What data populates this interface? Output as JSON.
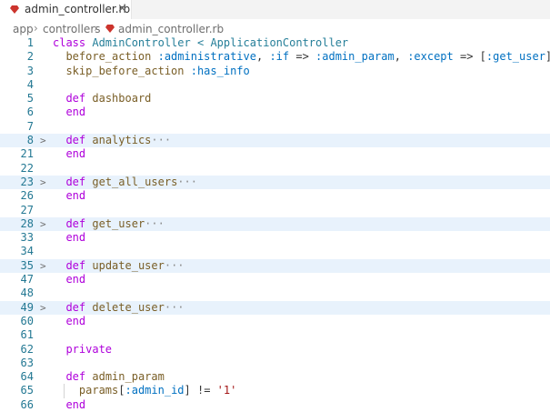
{
  "tab": {
    "filename": "admin_controller.rb",
    "close_glyph": "×"
  },
  "breadcrumb": {
    "parts": [
      "app",
      "controllers",
      "admin_controller.rb"
    ],
    "separator": "›"
  },
  "colors": {
    "keyword": "#0000ff",
    "control": "#af00db",
    "class": "#267f99",
    "symbol": "#0070c1",
    "function": "#795e26",
    "string": "#a31515",
    "line_number": "#237893",
    "fold_highlight": "#e8f2fc",
    "ruby_icon": "#cc342d"
  },
  "editor": {
    "lines": [
      {
        "num": "1",
        "fold": "",
        "folded": false,
        "tokens": [
          [
            "kw-purple",
            "class"
          ],
          [
            "plain",
            " "
          ],
          [
            "cls",
            "AdminController"
          ],
          [
            "plain",
            " "
          ],
          [
            "cls",
            "<"
          ],
          [
            "plain",
            " "
          ],
          [
            "cls",
            "ApplicationController"
          ]
        ]
      },
      {
        "num": "2",
        "fold": "",
        "folded": false,
        "tokens": [
          [
            "plain",
            "  "
          ],
          [
            "fn",
            "before_action"
          ],
          [
            "plain",
            " "
          ],
          [
            "sym",
            ":administrative"
          ],
          [
            "plain",
            ", "
          ],
          [
            "sym",
            ":if"
          ],
          [
            "plain",
            " => "
          ],
          [
            "sym",
            ":admin_param"
          ],
          [
            "plain",
            ", "
          ],
          [
            "sym",
            ":except"
          ],
          [
            "plain",
            " => ["
          ],
          [
            "sym",
            ":get_user"
          ],
          [
            "plain",
            "]"
          ]
        ]
      },
      {
        "num": "3",
        "fold": "",
        "folded": false,
        "tokens": [
          [
            "plain",
            "  "
          ],
          [
            "fn",
            "skip_before_action"
          ],
          [
            "plain",
            " "
          ],
          [
            "sym",
            ":has_info"
          ]
        ]
      },
      {
        "num": "4",
        "fold": "",
        "folded": false,
        "tokens": []
      },
      {
        "num": "5",
        "fold": "",
        "folded": false,
        "tokens": [
          [
            "plain",
            "  "
          ],
          [
            "kw-purple",
            "def"
          ],
          [
            "plain",
            " "
          ],
          [
            "fn",
            "dashboard"
          ]
        ]
      },
      {
        "num": "6",
        "fold": "",
        "folded": false,
        "tokens": [
          [
            "plain",
            "  "
          ],
          [
            "kw-purple",
            "end"
          ]
        ]
      },
      {
        "num": "7",
        "fold": "",
        "folded": false,
        "tokens": []
      },
      {
        "num": "8",
        "fold": ">",
        "folded": true,
        "tokens": [
          [
            "plain",
            "  "
          ],
          [
            "kw-purple",
            "def"
          ],
          [
            "plain",
            " "
          ],
          [
            "fn",
            "analytics"
          ],
          [
            "ell",
            "···"
          ]
        ]
      },
      {
        "num": "21",
        "fold": "",
        "folded": false,
        "tokens": [
          [
            "plain",
            "  "
          ],
          [
            "kw-purple",
            "end"
          ]
        ]
      },
      {
        "num": "22",
        "fold": "",
        "folded": false,
        "tokens": []
      },
      {
        "num": "23",
        "fold": ">",
        "folded": true,
        "tokens": [
          [
            "plain",
            "  "
          ],
          [
            "kw-purple",
            "def"
          ],
          [
            "plain",
            " "
          ],
          [
            "fn",
            "get_all_users"
          ],
          [
            "ell",
            "···"
          ]
        ]
      },
      {
        "num": "26",
        "fold": "",
        "folded": false,
        "tokens": [
          [
            "plain",
            "  "
          ],
          [
            "kw-purple",
            "end"
          ]
        ]
      },
      {
        "num": "27",
        "fold": "",
        "folded": false,
        "tokens": []
      },
      {
        "num": "28",
        "fold": ">",
        "folded": true,
        "tokens": [
          [
            "plain",
            "  "
          ],
          [
            "kw-purple",
            "def"
          ],
          [
            "plain",
            " "
          ],
          [
            "fn",
            "get_user"
          ],
          [
            "ell",
            "···"
          ]
        ]
      },
      {
        "num": "33",
        "fold": "",
        "folded": false,
        "tokens": [
          [
            "plain",
            "  "
          ],
          [
            "kw-purple",
            "end"
          ]
        ]
      },
      {
        "num": "34",
        "fold": "",
        "folded": false,
        "tokens": []
      },
      {
        "num": "35",
        "fold": ">",
        "folded": true,
        "tokens": [
          [
            "plain",
            "  "
          ],
          [
            "kw-purple",
            "def"
          ],
          [
            "plain",
            " "
          ],
          [
            "fn",
            "update_user"
          ],
          [
            "ell",
            "···"
          ]
        ]
      },
      {
        "num": "47",
        "fold": "",
        "folded": false,
        "tokens": [
          [
            "plain",
            "  "
          ],
          [
            "kw-purple",
            "end"
          ]
        ]
      },
      {
        "num": "48",
        "fold": "",
        "folded": false,
        "tokens": []
      },
      {
        "num": "49",
        "fold": ">",
        "folded": true,
        "tokens": [
          [
            "plain",
            "  "
          ],
          [
            "kw-purple",
            "def"
          ],
          [
            "plain",
            " "
          ],
          [
            "fn",
            "delete_user"
          ],
          [
            "ell",
            "···"
          ]
        ]
      },
      {
        "num": "60",
        "fold": "",
        "folded": false,
        "tokens": [
          [
            "plain",
            "  "
          ],
          [
            "kw-purple",
            "end"
          ]
        ]
      },
      {
        "num": "61",
        "fold": "",
        "folded": false,
        "tokens": []
      },
      {
        "num": "62",
        "fold": "",
        "folded": false,
        "tokens": [
          [
            "plain",
            "  "
          ],
          [
            "kw-purple",
            "private"
          ]
        ]
      },
      {
        "num": "63",
        "fold": "",
        "folded": false,
        "tokens": []
      },
      {
        "num": "64",
        "fold": "",
        "folded": false,
        "tokens": [
          [
            "plain",
            "  "
          ],
          [
            "kw-purple",
            "def"
          ],
          [
            "plain",
            " "
          ],
          [
            "fn",
            "admin_param"
          ]
        ]
      },
      {
        "num": "65",
        "fold": "",
        "folded": false,
        "tokens": [
          [
            "plain",
            "    "
          ],
          [
            "fn",
            "params"
          ],
          [
            "plain",
            "["
          ],
          [
            "sym",
            ":admin_id"
          ],
          [
            "plain",
            "] != "
          ],
          [
            "str",
            "'1'"
          ]
        ]
      },
      {
        "num": "66",
        "fold": "",
        "folded": false,
        "tokens": [
          [
            "plain",
            "  "
          ],
          [
            "kw-purple",
            "end"
          ]
        ]
      }
    ]
  }
}
